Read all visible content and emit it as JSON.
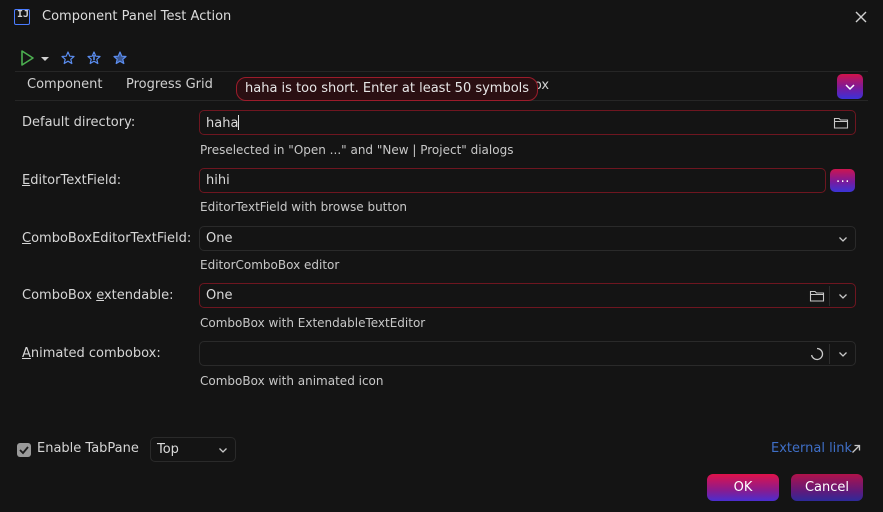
{
  "window": {
    "title": "Component Panel Test Action"
  },
  "tabs": [
    {
      "label": "Component"
    },
    {
      "label": "Progress Grid"
    }
  ],
  "tab_tail_text": "oBox",
  "tooltip": {
    "text": "haha is too short. Enter at least 50 symbols"
  },
  "form": {
    "default_directory": {
      "label": "Default directory:",
      "value": "haha",
      "hint": "Preselected in \"Open ...\" and \"New | Project\" dialogs"
    },
    "editor_text_field": {
      "label_mnemonic": "E",
      "label_rest": "ditorTextField:",
      "value": "hihi",
      "hint": "EditorTextField with browse button",
      "browse_label": "..."
    },
    "combobox_editor": {
      "label_mnemonic": "C",
      "label_rest": "omboBoxEditorTextField:",
      "value": "One",
      "hint": "EditorComboBox editor"
    },
    "combobox_extendable": {
      "label_pre": "ComboBox ",
      "label_mnemonic": "e",
      "label_rest": "xtendable:",
      "value": "One",
      "hint": "ComboBox with ExtendableTextEditor"
    },
    "animated_combobox": {
      "label_mnemonic": "A",
      "label_rest": "nimated combobox:",
      "value": "",
      "hint": "ComboBox with animated icon"
    }
  },
  "bottom": {
    "enable_tabpane": {
      "label": "Enable TabPane",
      "checked": true
    },
    "tab_placement": {
      "value": "Top"
    },
    "external_link": {
      "label": "External link"
    }
  },
  "buttons": {
    "ok": "OK",
    "cancel": "Cancel"
  },
  "colors": {
    "accent_gradient_top": "#e0124a",
    "accent_gradient_bottom": "#4a2ed0",
    "error_border": "#6e1620",
    "link": "#3f6fc7",
    "run_icon": "#4caf50",
    "star_icon": "#5b8def"
  }
}
